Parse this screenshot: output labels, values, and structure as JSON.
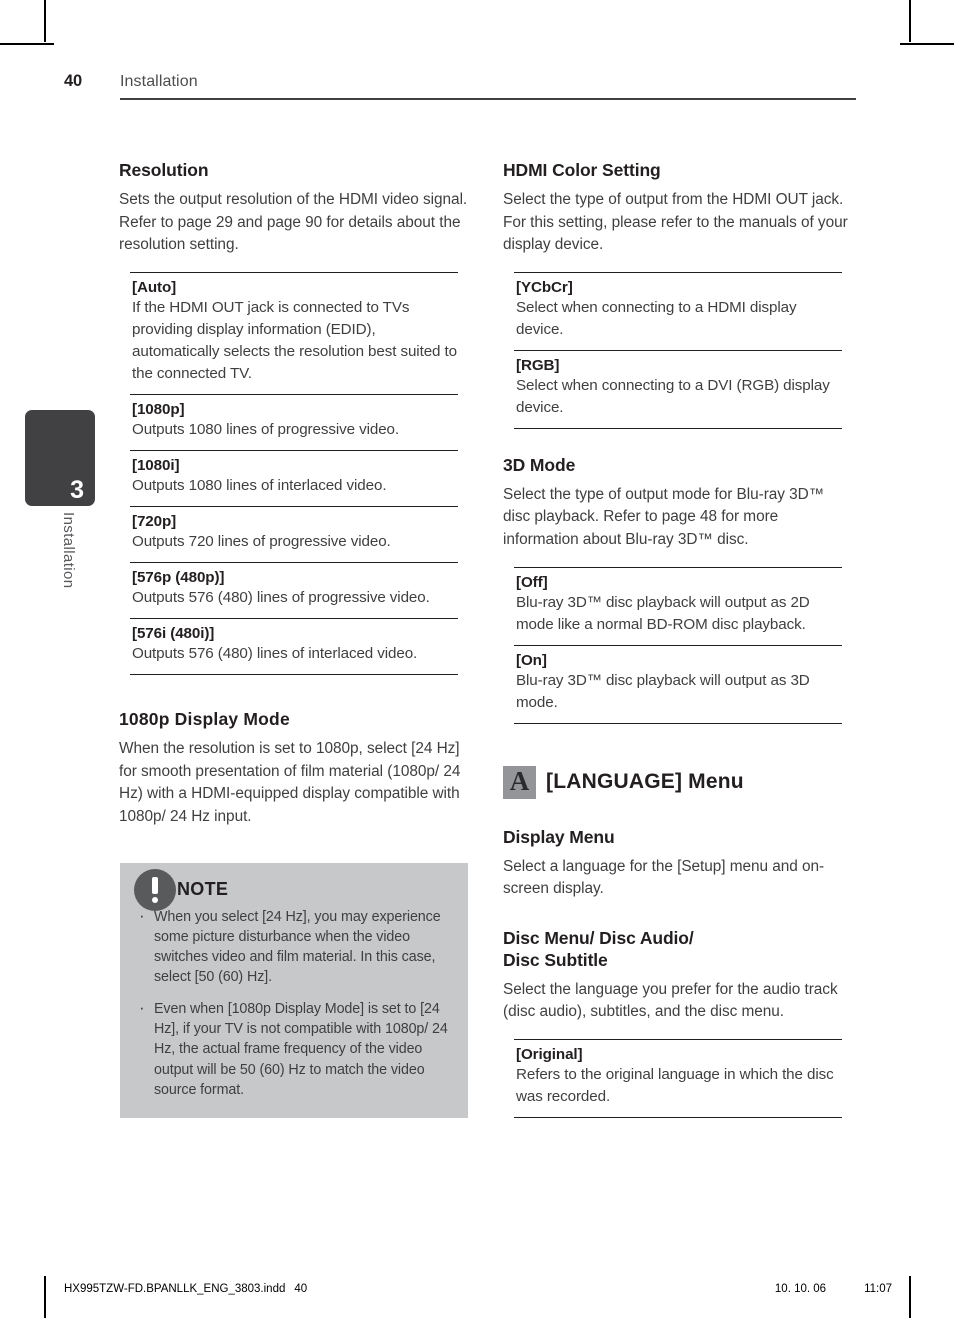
{
  "header": {
    "page_number": "40",
    "section": "Installation"
  },
  "side_tab": {
    "chapter_number": "3",
    "chapter_label": "Installation"
  },
  "left_column": {
    "resolution": {
      "title": "Resolution",
      "body": "Sets the output resolution of the HDMI video signal. Refer to page 29 and page 90 for details about the resolution setting.",
      "items": [
        {
          "term": "[Auto]",
          "desc": "If the HDMI OUT jack is connected to TVs providing display information (EDID), automatically selects the resolution best suited to the connected TV."
        },
        {
          "term": "[1080p]",
          "desc": "Outputs 1080 lines of progressive video."
        },
        {
          "term": "[1080i]",
          "desc": "Outputs 1080 lines of interlaced video."
        },
        {
          "term": "[720p]",
          "desc": "Outputs 720 lines of progressive video."
        },
        {
          "term": "[576p (480p)]",
          "desc": "Outputs 576 (480) lines of progressive video."
        },
        {
          "term": "[576i (480i)]",
          "desc": "Outputs 576 (480) lines of interlaced video."
        }
      ]
    },
    "display_mode": {
      "title": "1080p Display Mode",
      "body": "When the resolution is set to 1080p, select [24 Hz] for smooth presentation of film material (1080p/ 24 Hz) with a HDMI-equipped display compatible with 1080p/ 24 Hz input."
    },
    "note": {
      "title": "NOTE",
      "icon": "exclamation-circle-icon",
      "bullets": [
        "When you select [24 Hz], you may experience some picture disturbance when the video switches video and film material. In this case, select [50 (60) Hz].",
        "Even when [1080p Display Mode] is set to [24 Hz], if your TV is not compatible with 1080p/ 24 Hz, the actual frame frequency of the video output will be 50 (60) Hz to match the video source format."
      ]
    }
  },
  "right_column": {
    "hdmi_color": {
      "title": "HDMI Color Setting",
      "body": "Select the type of output from the HDMI OUT jack. For this setting, please refer to the manuals of your display device.",
      "items": [
        {
          "term": "[YCbCr]",
          "desc": "Select when connecting to a HDMI display device."
        },
        {
          "term": "[RGB]",
          "desc": "Select when connecting to a DVI (RGB) display device."
        }
      ]
    },
    "three_d_mode": {
      "title": "3D Mode",
      "body": "Select the type of output mode for Blu-ray 3D™ disc playback. Refer to page 48 for more information about Blu-ray 3D™ disc.",
      "items": [
        {
          "term": "[Off]",
          "desc": "Blu-ray 3D™ disc playback will output as 2D mode like a normal BD-ROM disc playback."
        },
        {
          "term": "[On]",
          "desc": "Blu-ray 3D™ disc playback will output as 3D mode."
        }
      ]
    },
    "language_menu": {
      "icon_letter": "A",
      "icon_name": "language-a-icon",
      "title": "[LANGUAGE] Menu",
      "display_menu": {
        "title": "Display Menu",
        "body": "Select a language for the [Setup] menu and on-screen display."
      },
      "disc_menu": {
        "title_line1": "Disc Menu/ Disc Audio/",
        "title_line2": "Disc Subtitle",
        "body": "Select the language you prefer for the audio track (disc audio), subtitles, and the disc menu.",
        "items": [
          {
            "term": "[Original]",
            "desc": "Refers to the original language in which the disc was recorded."
          }
        ]
      }
    }
  },
  "footer": {
    "file_name": "HX995TZW-FD.BPANLLK_ENG_3803.indd",
    "page_number": "40",
    "date": "10. 10. 06",
    "time": "11:07"
  },
  "colors": {
    "ink": "#231f20",
    "body_text": "#3f3f41",
    "tab_dark": "#414042",
    "note_bg": "#c7c8ca",
    "note_badge": "#595a5c",
    "icon_gray": "#939598"
  }
}
